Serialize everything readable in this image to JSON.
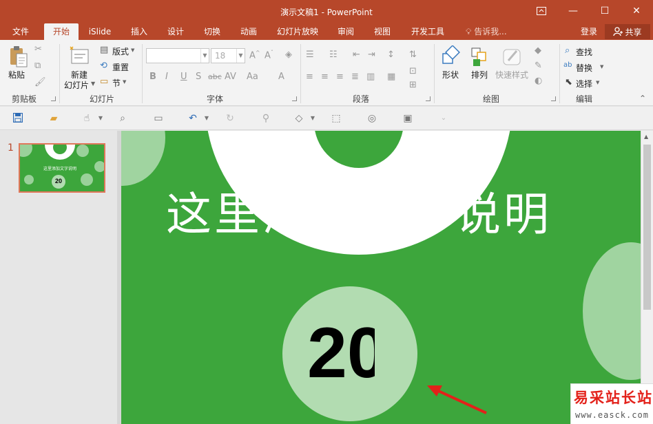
{
  "window": {
    "title": "演示文稿1 - PowerPoint",
    "restore_icon": "ribbon-display-icon",
    "minimize_glyph": "—",
    "maximize_glyph": "☐",
    "close_glyph": "✕"
  },
  "tabs": [
    {
      "label": "文件"
    },
    {
      "label": "开始",
      "active": true
    },
    {
      "label": "iSlide"
    },
    {
      "label": "插入"
    },
    {
      "label": "设计"
    },
    {
      "label": "切换"
    },
    {
      "label": "动画"
    },
    {
      "label": "幻灯片放映"
    },
    {
      "label": "审阅"
    },
    {
      "label": "视图"
    },
    {
      "label": "开发工具"
    }
  ],
  "tell_me": "告诉我...",
  "login": "登录",
  "share": "共享",
  "ribbon": {
    "clipboard": {
      "paste": "粘贴",
      "label": "剪贴板"
    },
    "slides": {
      "new_slide_line1": "新建",
      "new_slide_line2": "幻灯片",
      "layout": "版式",
      "reset": "重置",
      "section": "节",
      "label": "幻灯片"
    },
    "font": {
      "font_name": "",
      "font_size": "18",
      "label": "字体"
    },
    "paragraph": {
      "label": "段落"
    },
    "drawing": {
      "shape": "形状",
      "arrange": "排列",
      "quick_styles": "快速样式",
      "label": "绘图"
    },
    "editing": {
      "find": "查找",
      "replace": "替换",
      "select": "选择",
      "label": "编辑"
    }
  },
  "thumbnails": [
    {
      "number": "1",
      "title": "这里添加文字说明",
      "number_text": "20"
    }
  ],
  "slide": {
    "title": "这里添加文字说明",
    "number_text": "20"
  },
  "watermark": {
    "cn": "易采站长站",
    "en": "www.easck.com"
  },
  "colors": {
    "accent": "#b7472a",
    "slide_green": "#3da63c",
    "light_green": "#b2dcb1"
  }
}
